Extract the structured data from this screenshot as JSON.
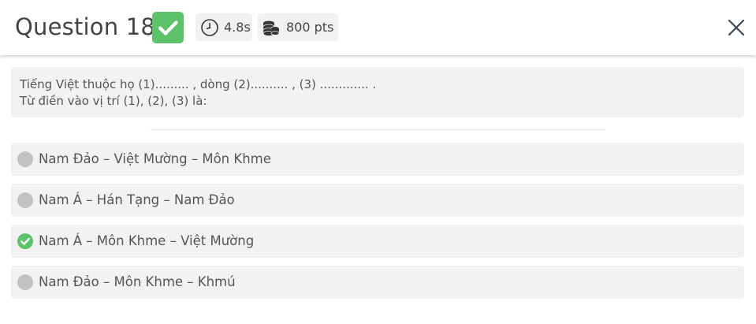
{
  "header": {
    "title": "Question 18",
    "correct_icon": "check-icon",
    "time_icon": "stopwatch-icon",
    "time": "4.8s",
    "points_icon": "coins-icon",
    "points": "800 pts",
    "close_icon": "close-icon"
  },
  "question": {
    "line1": "Tiếng Việt thuộc họ (1)......... , dòng (2).......... , (3) ............. .",
    "line2": "Từ điền vào vị trí (1), (2), (3) là:"
  },
  "options": [
    {
      "label": "Nam Đảo – Việt Mường – Môn Khme",
      "correct": false
    },
    {
      "label": "Nam Á – Hán Tạng – Nam Đảo",
      "correct": false
    },
    {
      "label": "Nam Á – Môn Khme – Việt Mường",
      "correct": true
    },
    {
      "label": "Nam Đảo – Môn Khme – Khmú",
      "correct": false
    }
  ],
  "colors": {
    "correct": "#5cc36b",
    "unselected_marker": "#c2c2c2",
    "panel_bg": "#f2f2f2"
  }
}
